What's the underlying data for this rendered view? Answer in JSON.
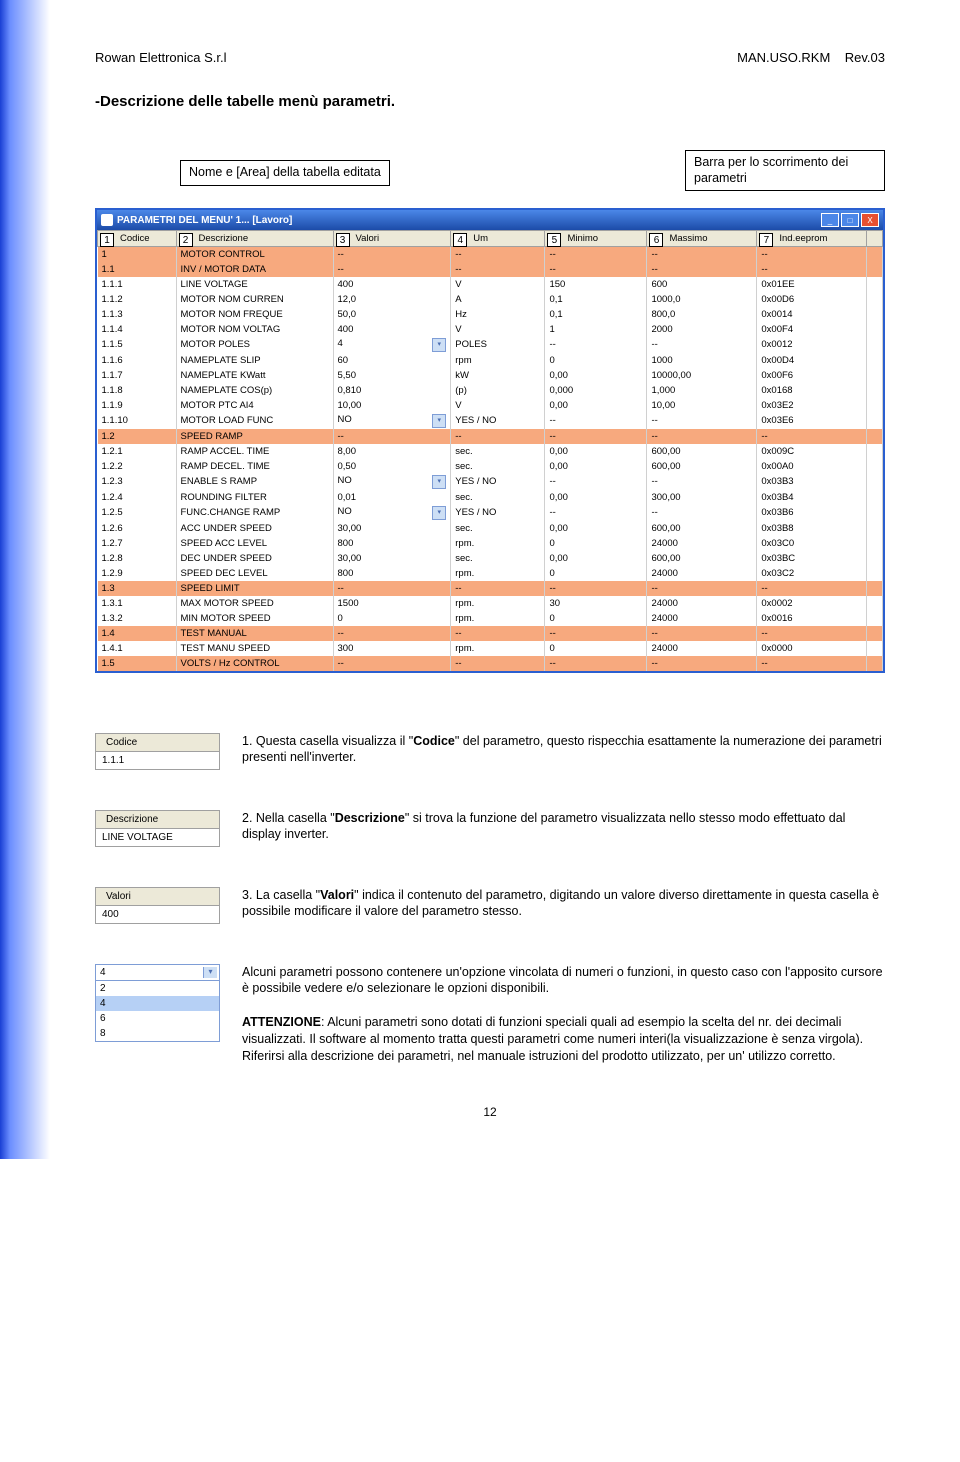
{
  "doc": {
    "company": "Rowan Elettronica S.r.l",
    "manual": "MAN.USO.RKM",
    "rev": "Rev.03",
    "section_title": "-Descrizione delle tabelle menù parametri.",
    "page": "12"
  },
  "callouts": {
    "left": "Nome e [Area] della tabella editata",
    "right": "Barra per lo scorrimento dei parametri"
  },
  "window": {
    "title": "PARAMETRI DEL MENU' 1... [Lavoro]",
    "min": "_",
    "max": "□",
    "close": "X"
  },
  "columns": {
    "c1": "Codice",
    "c2": "Descrizione",
    "c3": "Valori",
    "c4": "Um",
    "c5": "Minimo",
    "c6": "Massimo",
    "c7": "Ind.eeprom"
  },
  "col_nums": {
    "n1": "1",
    "n2": "2",
    "n3": "3",
    "n4": "4",
    "n5": "5",
    "n6": "6",
    "n7": "7"
  },
  "rows": [
    {
      "cls": "orange",
      "c": [
        "1",
        "MOTOR CONTROL",
        "--",
        "--",
        "--",
        "--",
        "--"
      ]
    },
    {
      "cls": "orange",
      "c": [
        "1.1",
        "INV / MOTOR DATA",
        "--",
        "--",
        "--",
        "--",
        "--"
      ]
    },
    {
      "cls": "normal",
      "c": [
        "1.1.1",
        "LINE VOLTAGE",
        "400",
        "V",
        "150",
        "600",
        "0x01EE"
      ]
    },
    {
      "cls": "normal",
      "c": [
        "1.1.2",
        "MOTOR NOM CURREN",
        "12,0",
        "A",
        "0,1",
        "1000,0",
        "0x00D6"
      ]
    },
    {
      "cls": "normal",
      "c": [
        "1.1.3",
        "MOTOR NOM FREQUE",
        "50,0",
        "Hz",
        "0,1",
        "800,0",
        "0x0014"
      ]
    },
    {
      "cls": "normal",
      "c": [
        "1.1.4",
        "MOTOR NOM VOLTAG",
        "400",
        "V",
        "1",
        "2000",
        "0x00F4"
      ]
    },
    {
      "cls": "normal",
      "c": [
        "1.1.5",
        "MOTOR POLES",
        "4",
        "POLES",
        "--",
        "--",
        "0x0012"
      ],
      "dd": true
    },
    {
      "cls": "normal",
      "c": [
        "1.1.6",
        "NAMEPLATE SLIP",
        "60",
        "rpm",
        "0",
        "1000",
        "0x00D4"
      ]
    },
    {
      "cls": "normal",
      "c": [
        "1.1.7",
        "NAMEPLATE KWatt",
        "5,50",
        "kW",
        "0,00",
        "10000,00",
        "0x00F6"
      ]
    },
    {
      "cls": "normal",
      "c": [
        "1.1.8",
        "NAMEPLATE COS(p)",
        "0,810",
        "(p)",
        "0,000",
        "1,000",
        "0x0168"
      ]
    },
    {
      "cls": "normal",
      "c": [
        "1.1.9",
        "MOTOR PTC AI4",
        "10,00",
        "V",
        "0,00",
        "10,00",
        "0x03E2"
      ]
    },
    {
      "cls": "normal",
      "c": [
        "1.1.10",
        "MOTOR LOAD FUNC",
        "NO",
        "YES / NO",
        "--",
        "--",
        "0x03E6"
      ],
      "dd": true
    },
    {
      "cls": "orange",
      "c": [
        "1.2",
        "SPEED RAMP",
        "--",
        "--",
        "--",
        "--",
        "--"
      ]
    },
    {
      "cls": "normal",
      "c": [
        "1.2.1",
        "RAMP ACCEL. TIME",
        "8,00",
        "sec.",
        "0,00",
        "600,00",
        "0x009C"
      ]
    },
    {
      "cls": "normal",
      "c": [
        "1.2.2",
        "RAMP DECEL. TIME",
        "0,50",
        "sec.",
        "0,00",
        "600,00",
        "0x00A0"
      ]
    },
    {
      "cls": "normal",
      "c": [
        "1.2.3",
        "ENABLE S RAMP",
        "NO",
        "YES / NO",
        "--",
        "--",
        "0x03B3"
      ],
      "dd": true
    },
    {
      "cls": "normal",
      "c": [
        "1.2.4",
        "ROUNDING FILTER",
        "0,01",
        "sec.",
        "0,00",
        "300,00",
        "0x03B4"
      ]
    },
    {
      "cls": "normal",
      "c": [
        "1.2.5",
        "FUNC.CHANGE RAMP",
        "NO",
        "YES / NO",
        "--",
        "--",
        "0x03B6"
      ],
      "dd": true
    },
    {
      "cls": "normal",
      "c": [
        "1.2.6",
        "ACC UNDER SPEED",
        "30,00",
        "sec.",
        "0,00",
        "600,00",
        "0x03B8"
      ]
    },
    {
      "cls": "normal",
      "c": [
        "1.2.7",
        "SPEED ACC LEVEL",
        "800",
        "rpm.",
        "0",
        "24000",
        "0x03C0"
      ]
    },
    {
      "cls": "normal",
      "c": [
        "1.2.8",
        "DEC UNDER SPEED",
        "30,00",
        "sec.",
        "0,00",
        "600,00",
        "0x03BC"
      ]
    },
    {
      "cls": "normal",
      "c": [
        "1.2.9",
        "SPEED DEC LEVEL",
        "800",
        "rpm.",
        "0",
        "24000",
        "0x03C2"
      ]
    },
    {
      "cls": "orange",
      "c": [
        "1.3",
        "SPEED LIMIT",
        "--",
        "--",
        "--",
        "--",
        "--"
      ]
    },
    {
      "cls": "normal",
      "c": [
        "1.3.1",
        "MAX MOTOR SPEED",
        "1500",
        "rpm.",
        "30",
        "24000",
        "0x0002"
      ]
    },
    {
      "cls": "normal",
      "c": [
        "1.3.2",
        "MIN MOTOR SPEED",
        "0",
        "rpm.",
        "0",
        "24000",
        "0x0016"
      ]
    },
    {
      "cls": "orange",
      "c": [
        "1.4",
        "TEST MANUAL",
        "--",
        "--",
        "--",
        "--",
        "--"
      ]
    },
    {
      "cls": "normal",
      "c": [
        "1.4.1",
        "TEST MANU SPEED",
        "300",
        "rpm.",
        "0",
        "24000",
        "0x0000"
      ]
    },
    {
      "cls": "orange",
      "c": [
        "1.5",
        "VOLTS / Hz CONTROL",
        "--",
        "--",
        "--",
        "--",
        "--"
      ]
    }
  ],
  "mini": {
    "codice_hdr": "Codice",
    "codice_val": "1.1.1",
    "desc_hdr": "Descrizione",
    "desc_val": "LINE VOLTAGE",
    "valori_hdr": "Valori",
    "valori_val": "400",
    "dd_sel": "4",
    "dd_opts": [
      "2",
      "4",
      "6",
      "8"
    ]
  },
  "explain": {
    "p1_prefix": "1. Questa casella visualizza il \"",
    "p1_bold": "Codice",
    "p1_suffix": "\" del parametro, questo rispecchia esattamente la numerazione dei parametri presenti nell'inverter.",
    "p2_prefix": "2. Nella casella \"",
    "p2_bold": "Descrizione",
    "p2_suffix": "\" si trova la funzione del parametro visualizzata nello stesso modo effettuato dal display inverter.",
    "p3_prefix": "3. La casella \"",
    "p3_bold": "Valori",
    "p3_suffix": "\" indica il contenuto del parametro, digitando un valore diverso direttamente in questa casella è possibile modificare il valore del parametro stesso.",
    "p4": "Alcuni parametri possono contenere un'opzione vincolata di numeri o funzioni, in questo caso con l'apposito cursore è possibile vedere e/o selezionare le opzioni disponibili.",
    "p5_bold": "ATTENZIONE",
    "p5_rest": ": Alcuni parametri sono dotati di funzioni speciali quali ad esempio la scelta del nr. dei decimali visualizzati. Il software al momento tratta questi parametri come numeri interi(la visualizzazione è senza virgola). Riferirsi alla descrizione dei parametri, nel manuale istruzioni del prodotto utilizzato, per un' utilizzo corretto."
  }
}
